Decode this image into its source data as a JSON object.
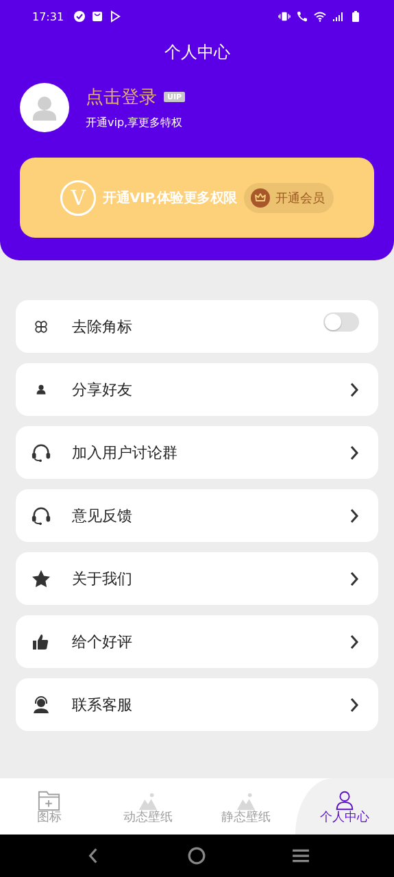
{
  "status_bar": {
    "time": "17:31"
  },
  "header": {
    "title": "个人中心"
  },
  "profile": {
    "name": "点击登录",
    "badge": "UIP",
    "subtitle": "开通vip,享更多特权"
  },
  "vip_banner": {
    "logo": "V",
    "text": "开通VIP,体验更多权限",
    "button": "开通会员"
  },
  "menu": [
    {
      "kind": "toggle",
      "label": "去除角标",
      "on": false
    },
    {
      "kind": "link",
      "label": "分享好友"
    },
    {
      "kind": "link",
      "label": "加入用户讨论群"
    },
    {
      "kind": "link",
      "label": "意见反馈"
    },
    {
      "kind": "link",
      "label": "关于我们"
    },
    {
      "kind": "link",
      "label": "给个好评"
    },
    {
      "kind": "link",
      "label": "联系客服"
    }
  ],
  "tabs": [
    {
      "label": "图标",
      "selected": false
    },
    {
      "label": "动态壁纸",
      "selected": false
    },
    {
      "label": "静态壁纸",
      "selected": false
    },
    {
      "label": "个人中心",
      "selected": true
    }
  ]
}
